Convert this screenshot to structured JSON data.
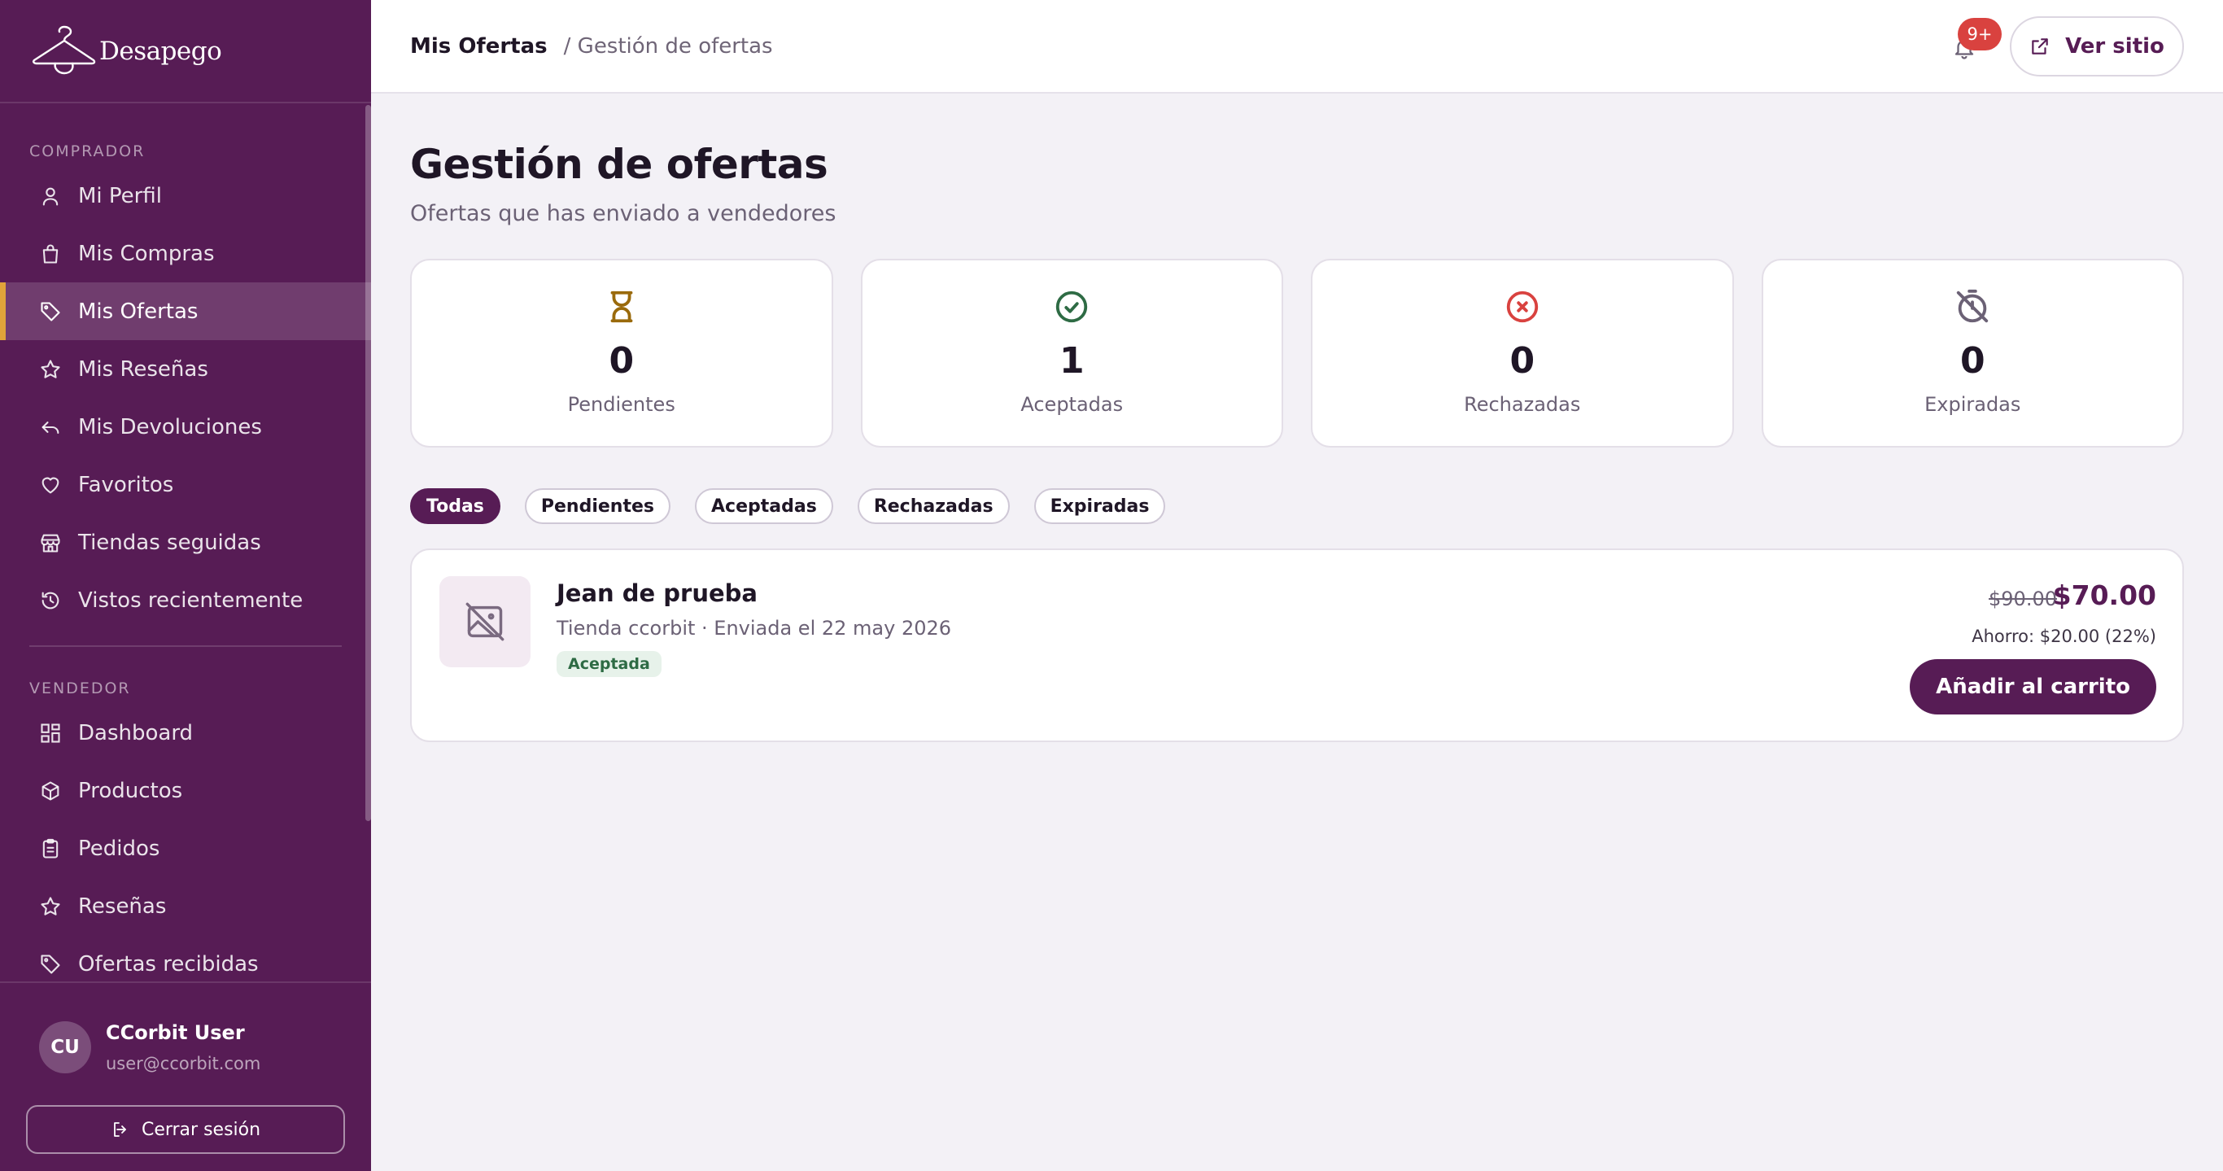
{
  "brand": {
    "name": "Desapego"
  },
  "sidebar": {
    "buyer_label": "COMPRADOR",
    "buyer_items": [
      {
        "label": "Mi Perfil",
        "icon": "user-icon"
      },
      {
        "label": "Mis Compras",
        "icon": "shopping-bag-icon"
      },
      {
        "label": "Mis Ofertas",
        "icon": "tag-icon",
        "active": true
      },
      {
        "label": "Mis Reseñas",
        "icon": "star-icon"
      },
      {
        "label": "Mis Devoluciones",
        "icon": "return-icon"
      },
      {
        "label": "Favoritos",
        "icon": "heart-icon"
      },
      {
        "label": "Tiendas seguidas",
        "icon": "store-icon"
      },
      {
        "label": "Vistos recientemente",
        "icon": "history-icon"
      }
    ],
    "seller_label": "VENDEDOR",
    "seller_items": [
      {
        "label": "Dashboard",
        "icon": "dashboard-icon"
      },
      {
        "label": "Productos",
        "icon": "box-icon"
      },
      {
        "label": "Pedidos",
        "icon": "clipboard-icon"
      },
      {
        "label": "Reseñas",
        "icon": "star-icon"
      },
      {
        "label": "Ofertas recibidas",
        "icon": "tag-icon"
      }
    ],
    "user": {
      "initials": "CU",
      "name": "CCorbit User",
      "email": "user@ccorbit.com"
    },
    "logout_label": "Cerrar sesión"
  },
  "topbar": {
    "breadcrumb_main": "Mis Ofertas",
    "breadcrumb_current": "/ Gestión de ofertas",
    "notifications_badge": "9+",
    "view_site_label": "Ver sitio"
  },
  "main": {
    "title": "Gestión de ofertas",
    "subtitle": "Ofertas que has enviado a vendedores",
    "stats": [
      {
        "value": "0",
        "label": "Pendientes",
        "icon": "hourglass-icon",
        "color": "#9a6a0c"
      },
      {
        "value": "1",
        "label": "Aceptadas",
        "icon": "check-circle-icon",
        "color": "#2e6b44"
      },
      {
        "value": "0",
        "label": "Rechazadas",
        "icon": "x-circle-icon",
        "color": "#d9423f"
      },
      {
        "value": "0",
        "label": "Expiradas",
        "icon": "timer-off-icon",
        "color": "#6b6175"
      }
    ],
    "filters": [
      {
        "label": "Todas",
        "active": true
      },
      {
        "label": "Pendientes"
      },
      {
        "label": "Aceptadas"
      },
      {
        "label": "Rechazadas"
      },
      {
        "label": "Expiradas"
      }
    ],
    "offers": [
      {
        "title": "Jean de prueba",
        "meta": "Tienda ccorbit · Enviada el 22 may 2026",
        "status": "Aceptada",
        "original_price": "$90.00",
        "offer_price": "$70.00",
        "saving": "Ahorro: $20.00 (22%)",
        "button": "Añadir al carrito"
      }
    ]
  },
  "colors": {
    "brand": "#571c55",
    "accent": "#e0a43a",
    "danger": "#d9423f",
    "success": "#2e6b44"
  }
}
